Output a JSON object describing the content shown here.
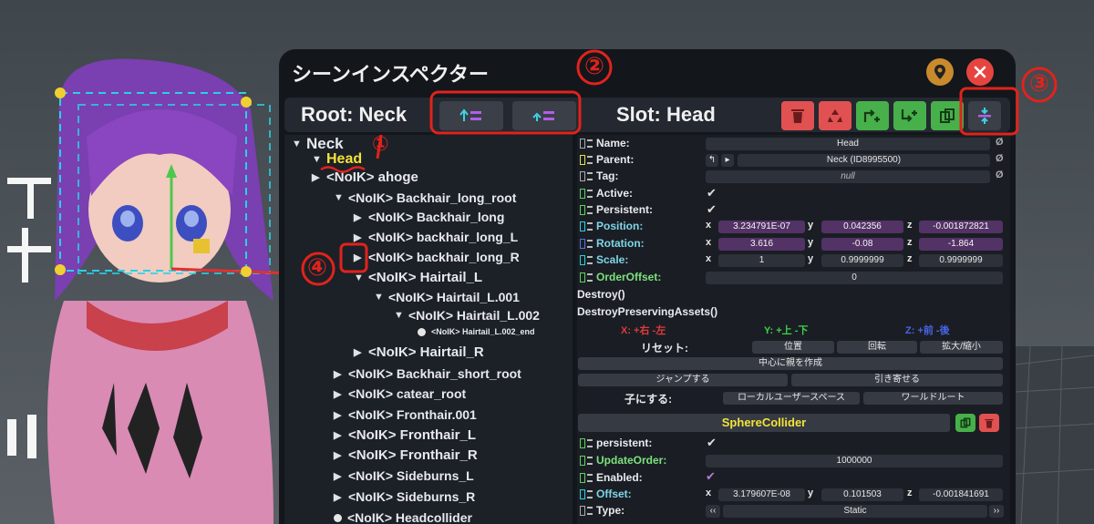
{
  "window": {
    "title": "シーンインスペクター"
  },
  "root_label": "Root: Neck",
  "slot_label": "Slot: Head",
  "tree": [
    {
      "label": "Neck",
      "arrow": "▼",
      "size": 17
    },
    {
      "label": "Head",
      "arrow": "▼",
      "size": 16,
      "highlight": true
    },
    {
      "label": "<NoIK> ahoge",
      "arrow": "▶",
      "size": 15
    },
    {
      "label": "<NoIK> Backhair_long_root",
      "arrow": "▼",
      "size": 14
    },
    {
      "label": "<NoIK> Backhair_long",
      "arrow": "▶",
      "size": 14
    },
    {
      "label": "<NoIK> backhair_long_L",
      "arrow": "▶",
      "size": 14
    },
    {
      "label": "<NoIK> backhair_long_R",
      "arrow": "▶",
      "size": 14
    },
    {
      "label": "<NoIK> Hairtail_L",
      "arrow": "▼",
      "size": 15
    },
    {
      "label": "<NoIK> Hairtail_L.001",
      "arrow": "▼",
      "size": 14
    },
    {
      "label": "<NoIK> Hairtail_L.002",
      "arrow": "▼",
      "size": 14
    },
    {
      "label": "<NoIK> Hairtail_L.002_end",
      "arrow": "dot",
      "size": 9
    },
    {
      "label": "<NoIK> Hairtail_R",
      "arrow": "▶",
      "size": 15
    },
    {
      "label": "<NoIK> Backhair_short_root",
      "arrow": "▶",
      "size": 14
    },
    {
      "label": "<NoIK> catear_root",
      "arrow": "▶",
      "size": 14
    },
    {
      "label": "<NoIK> Fronthair.001",
      "arrow": "▶",
      "size": 14
    },
    {
      "label": "<NoIK> Fronthair_L",
      "arrow": "▶",
      "size": 15
    },
    {
      "label": "<NoIK> Fronthair_R",
      "arrow": "▶",
      "size": 15
    },
    {
      "label": "<NoIK> Sideburns_L",
      "arrow": "▶",
      "size": 14
    },
    {
      "label": "<NoIK> Sideburns_R",
      "arrow": "▶",
      "size": 14
    },
    {
      "label": "<NoIK> Headcollider",
      "arrow": "dot",
      "size": 14
    }
  ],
  "slot": {
    "name_label": "Name:",
    "name_value": "Head",
    "parent_label": "Parent:",
    "parent_value": "Neck (ID8995500)",
    "tag_label": "Tag:",
    "tag_value": "null",
    "active_label": "Active:",
    "persistent_label": "Persistent:",
    "position_label": "Position:",
    "position": {
      "x": "3.234791E-07",
      "y": "0.042356",
      "z": "-0.001872821"
    },
    "rotation_label": "Rotation:",
    "rotation": {
      "x": "3.616",
      "y": "-0.08",
      "z": "-1.864"
    },
    "scale_label": "Scale:",
    "scale": {
      "x": "1",
      "y": "0.9999999",
      "z": "0.9999999"
    },
    "orderoffset_label": "OrderOffset:",
    "orderoffset": "0",
    "destroy": "Destroy()",
    "destroy_preserving": "DestroyPreservingAssets()",
    "axis_x": "X: +右 -左",
    "axis_y": "Y: +上 -下",
    "axis_z": "Z: +前 -後",
    "reset_label": "リセット:",
    "reset_position": "位置",
    "reset_rotation": "回転",
    "reset_scale": "拡大/縮小",
    "parent_center": "中心に親を作成",
    "jump": "ジャンプする",
    "pull": "引き寄せる",
    "child_label": "子にする:",
    "local_user": "ローカルユーザースペース",
    "world_root": "ワールドルート"
  },
  "component": {
    "name": "SphereCollider",
    "persistent_label": "persistent:",
    "updateorder_label": "UpdateOrder:",
    "updateorder": "1000000",
    "enabled_label": "Enabled:",
    "offset_label": "Offset:",
    "offset": {
      "x": "3.179607E-08",
      "y": "0.101503",
      "z": "-0.001841691"
    },
    "type_label": "Type:",
    "type_value": "Static"
  },
  "axes": {
    "x": "x",
    "y": "y",
    "z": "z"
  },
  "annotations": [
    "①",
    "②",
    "③",
    "④"
  ],
  "colors": {
    "panel": "#13161b",
    "tree_bg": "#1c2027",
    "head": "#f3e338",
    "purple": "#533266",
    "red_annot": "#e0231c"
  }
}
